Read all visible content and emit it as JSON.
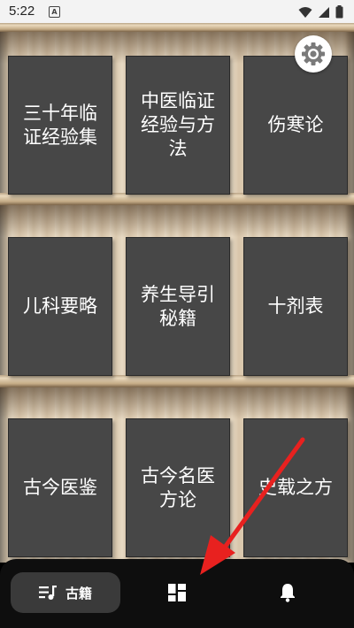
{
  "status_bar": {
    "time": "5:22",
    "notification_letter": "A"
  },
  "shelves": [
    {
      "books": [
        "三十年临证经验集",
        "中医临证经验与方法",
        "伤寒论"
      ]
    },
    {
      "books": [
        "儿科要略",
        "养生导引秘籍",
        "十剂表"
      ]
    },
    {
      "books": [
        "古今医鉴",
        "古今名医方论",
        "史载之方"
      ]
    }
  ],
  "bottom_nav": {
    "active_label": "古籍"
  },
  "colors": {
    "book": "#474747",
    "nav_background": "#0e0e0e",
    "nav_active": "#3a3a3a",
    "annotation_arrow": "#e8211f"
  }
}
